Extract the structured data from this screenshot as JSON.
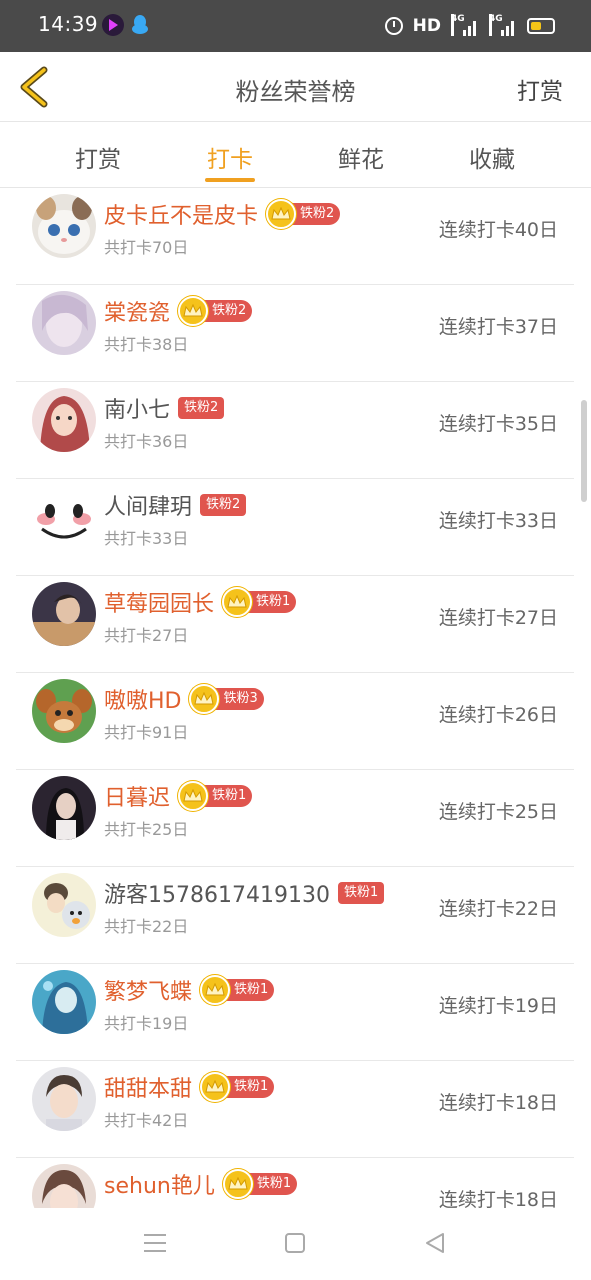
{
  "status_bar": {
    "time": "14:39",
    "hd": "HD",
    "net1": "4G",
    "net2": "4G"
  },
  "header": {
    "title": "粉丝荣誉榜",
    "right_action": "打赏",
    "back_icon": "chevron-left-icon"
  },
  "tabs": [
    {
      "label": "打赏",
      "active": false
    },
    {
      "label": "打卡",
      "active": true
    },
    {
      "label": "鲜花",
      "active": false
    },
    {
      "label": "收藏",
      "active": false
    }
  ],
  "colors": {
    "accent": "#f0a020",
    "name_highlight": "#e0602e",
    "badge": "#e0554e",
    "crown": "#f5c21b"
  },
  "fans": [
    {
      "name": "皮卡丘不是皮卡",
      "crown": true,
      "badge": "铁粉2",
      "total": "共打卡70日",
      "streak": "连续打卡40日",
      "highlight": true
    },
    {
      "name": "棠瓷瓷",
      "crown": true,
      "badge": "铁粉2",
      "total": "共打卡38日",
      "streak": "连续打卡37日",
      "highlight": true
    },
    {
      "name": "南小七",
      "crown": false,
      "badge": "铁粉2",
      "total": "共打卡36日",
      "streak": "连续打卡35日",
      "highlight": false
    },
    {
      "name": "人间肆玥",
      "crown": false,
      "badge": "铁粉2",
      "total": "共打卡33日",
      "streak": "连续打卡33日",
      "highlight": false
    },
    {
      "name": "草莓园园长",
      "crown": true,
      "badge": "铁粉1",
      "total": "共打卡27日",
      "streak": "连续打卡27日",
      "highlight": true
    },
    {
      "name": "嗷嗷HD",
      "crown": true,
      "badge": "铁粉3",
      "total": "共打卡91日",
      "streak": "连续打卡26日",
      "highlight": true
    },
    {
      "name": "日暮迟",
      "crown": true,
      "badge": "铁粉1",
      "total": "共打卡25日",
      "streak": "连续打卡25日",
      "highlight": true
    },
    {
      "name": "游客1578617419130",
      "crown": false,
      "badge": "铁粉1",
      "total": "共打卡22日",
      "streak": "连续打卡22日",
      "highlight": false
    },
    {
      "name": "繁梦飞蝶",
      "crown": true,
      "badge": "铁粉1",
      "total": "共打卡19日",
      "streak": "连续打卡19日",
      "highlight": true
    },
    {
      "name": "甜甜本甜",
      "crown": true,
      "badge": "铁粉1",
      "total": "共打卡42日",
      "streak": "连续打卡18日",
      "highlight": true
    },
    {
      "name": "sehun艳儿",
      "crown": true,
      "badge": "铁粉1",
      "total": "",
      "streak": "连续打卡18日",
      "highlight": true
    }
  ]
}
